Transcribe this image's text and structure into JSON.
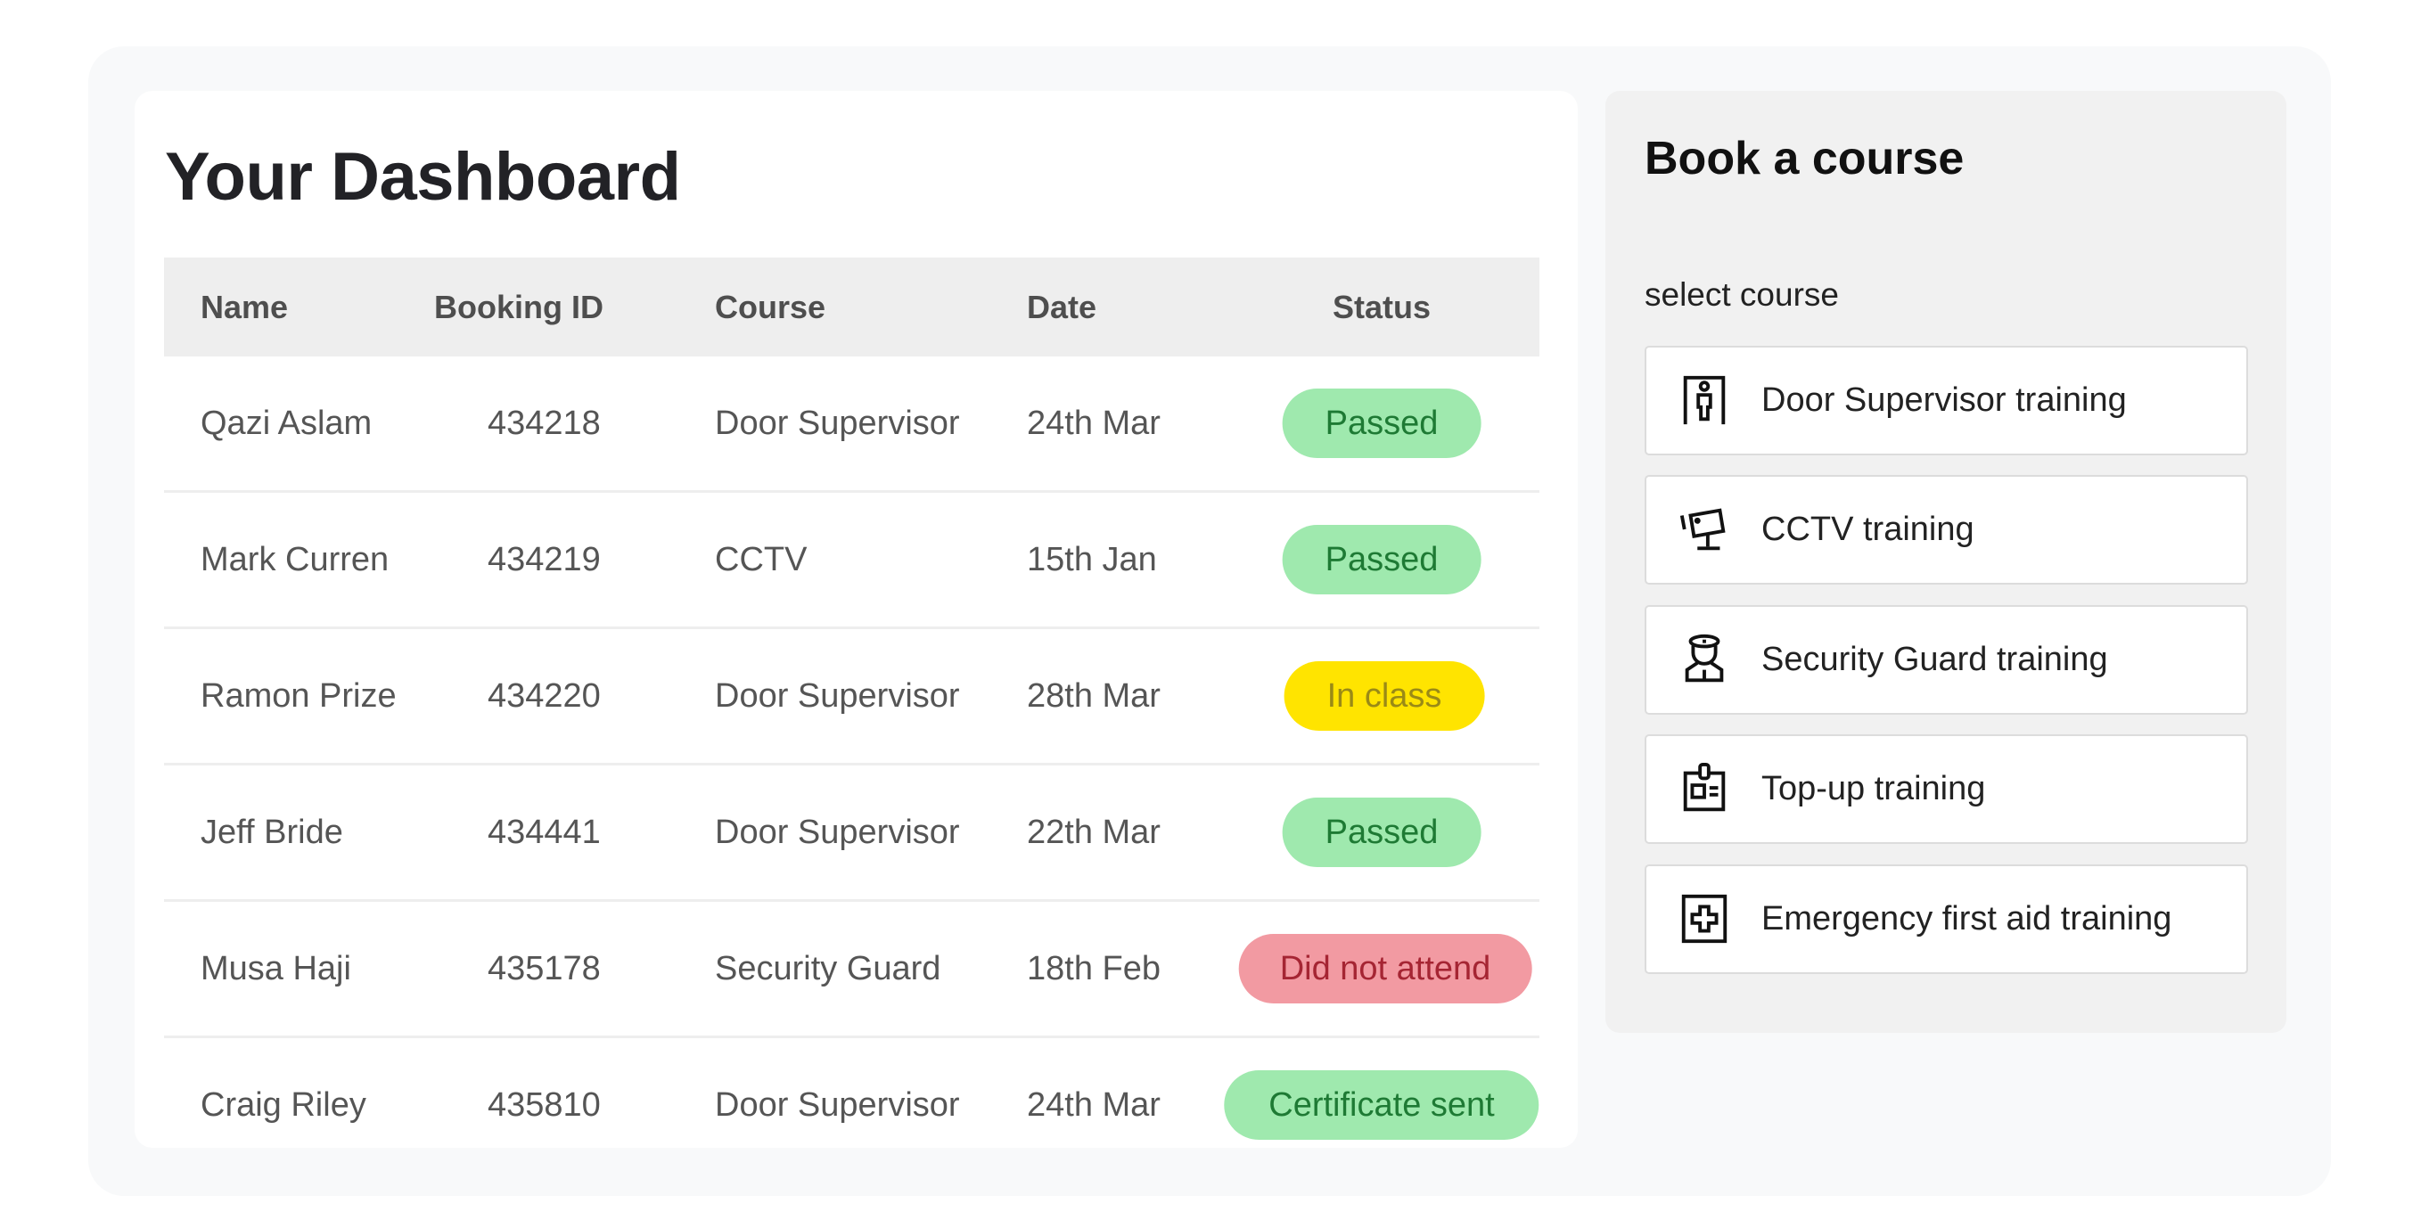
{
  "dashboard": {
    "title": "Your Dashboard",
    "columns": [
      "Name",
      "Booking ID",
      "Course",
      "Date",
      "Status"
    ],
    "rows": [
      {
        "name": "Qazi Aslam",
        "booking_id": "434218",
        "course": "Door Supervisor",
        "date": "24th Mar",
        "status": "Passed",
        "status_type": "passed"
      },
      {
        "name": "Mark Curren",
        "booking_id": "434219",
        "course": "CCTV",
        "date": "15th Jan",
        "status": "Passed",
        "status_type": "passed"
      },
      {
        "name": "Ramon Prize",
        "booking_id": "434220",
        "course": "Door Supervisor",
        "date": "28th Mar",
        "status": "In class",
        "status_type": "in-class"
      },
      {
        "name": "Jeff Bride",
        "booking_id": "434441",
        "course": "Door Supervisor",
        "date": "22th Mar",
        "status": "Passed",
        "status_type": "passed"
      },
      {
        "name": "Musa Haji",
        "booking_id": "435178",
        "course": "Security Guard",
        "date": "18th Feb",
        "status": "Did not attend",
        "status_type": "did-not-attend"
      },
      {
        "name": "Craig Riley",
        "booking_id": "435810",
        "course": "Door Supervisor",
        "date": "24th Mar",
        "status": "Certificate sent",
        "status_type": "certificate-sent"
      }
    ],
    "status_colors": {
      "passed": {
        "bg": "#9fe9ae",
        "text": "#1e7a34"
      },
      "in-class": {
        "bg": "#ffe400",
        "text": "#9a8a16"
      },
      "did-not-attend": {
        "bg": "#f29aa2",
        "text": "#a52533"
      },
      "certificate-sent": {
        "bg": "#9fe9ae",
        "text": "#1e7a34"
      }
    }
  },
  "booking": {
    "title": "Book a course",
    "select_label": "select course",
    "options": [
      {
        "label": "Door Supervisor training",
        "icon": "door-supervisor-icon"
      },
      {
        "label": "CCTV training",
        "icon": "cctv-camera-icon"
      },
      {
        "label": "Security Guard training",
        "icon": "security-guard-icon"
      },
      {
        "label": "Top-up training",
        "icon": "id-badge-icon"
      },
      {
        "label": "Emergency first aid training",
        "icon": "first-aid-icon"
      }
    ]
  }
}
